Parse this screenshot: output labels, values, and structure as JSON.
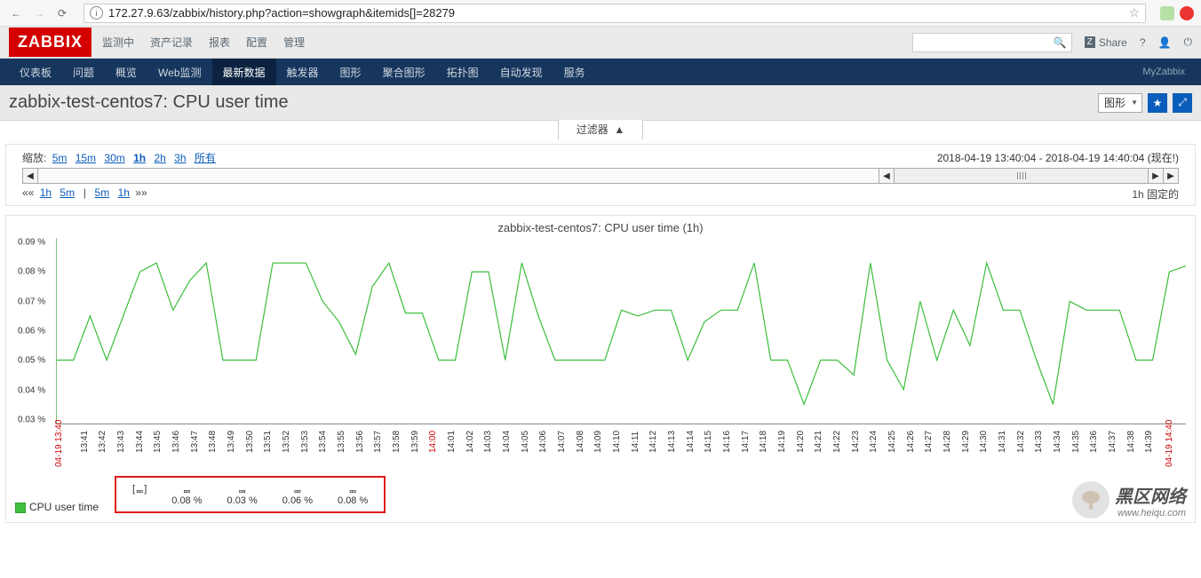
{
  "browser": {
    "url": "172.27.9.63/zabbix/history.php?action=showgraph&itemids[]=28279"
  },
  "topnav": {
    "logo": "ZABBIX",
    "items": [
      "监测中",
      "资产记录",
      "报表",
      "配置",
      "管理"
    ],
    "share": "Share"
  },
  "subnav": {
    "items": [
      "仪表板",
      "问题",
      "概览",
      "Web监测",
      "最新数据",
      "触发器",
      "图形",
      "聚合图形",
      "拓扑图",
      "自动发现",
      "服务"
    ],
    "active_index": 4,
    "right": "MyZabbix"
  },
  "pagehead": {
    "title": "zabbix-test-centos7: CPU user time",
    "dropdown": "图形"
  },
  "filter_tab": "过滤器",
  "controls": {
    "zoom_label": "缩放:",
    "zoom_opts": [
      "5m",
      "15m",
      "30m",
      "1h",
      "2h",
      "3h",
      "所有"
    ],
    "zoom_active": "1h",
    "timerange": "2018-04-19 13:40:04 - 2018-04-19 14:40:04 (现在!)",
    "row3_left_prefix": "««",
    "row3_left": [
      "1h",
      "5m"
    ],
    "row3_sep": "|",
    "row3_right": [
      "5m",
      "1h"
    ],
    "row3_right_suffix": "»»",
    "fixed": "1h  固定的"
  },
  "chart_data": {
    "type": "line",
    "title": "zabbix-test-centos7: CPU user time (1h)",
    "ylabel": "%",
    "ylim": [
      0.03,
      0.09
    ],
    "yticks": [
      "0.09 %",
      "0.08 %",
      "0.07 %",
      "0.06 %",
      "0.05 %",
      "0.04 %",
      "0.03 %"
    ],
    "x_start": "04-19 13:40",
    "x_end": "04-19 14:40",
    "xticks_red": [
      "14:00"
    ],
    "xticks": [
      "13:41",
      "13:42",
      "13:43",
      "13:44",
      "13:45",
      "13:46",
      "13:47",
      "13:48",
      "13:49",
      "13:50",
      "13:51",
      "13:52",
      "13:53",
      "13:54",
      "13:55",
      "13:56",
      "13:57",
      "13:58",
      "13:59",
      "14:00",
      "14:01",
      "14:02",
      "14:03",
      "14:04",
      "14:05",
      "14:06",
      "14:07",
      "14:08",
      "14:09",
      "14:10",
      "14:11",
      "14:12",
      "14:13",
      "14:14",
      "14:15",
      "14:16",
      "14:17",
      "14:18",
      "14:19",
      "14:20",
      "14:21",
      "14:22",
      "14:23",
      "14:24",
      "14:25",
      "14:26",
      "14:27",
      "14:28",
      "14:29",
      "14:30",
      "14:31",
      "14:32",
      "14:33",
      "14:34",
      "14:35",
      "14:36",
      "14:37",
      "14:38",
      "14:39"
    ],
    "values": [
      0.05,
      0.05,
      0.065,
      0.05,
      0.065,
      0.08,
      0.083,
      0.067,
      0.077,
      0.083,
      0.05,
      0.05,
      0.05,
      0.083,
      0.083,
      0.083,
      0.07,
      0.063,
      0.052,
      0.075,
      0.083,
      0.066,
      0.066,
      0.05,
      0.05,
      0.08,
      0.08,
      0.05,
      0.083,
      0.065,
      0.05,
      0.05,
      0.05,
      0.05,
      0.067,
      0.065,
      0.067,
      0.067,
      0.05,
      0.063,
      0.067,
      0.067,
      0.083,
      0.05,
      0.05,
      0.035,
      0.05,
      0.05,
      0.045,
      0.083,
      0.05,
      0.04,
      0.07,
      0.05,
      0.067,
      0.055,
      0.083,
      0.067,
      0.067,
      0.05,
      0.035,
      0.07,
      0.067,
      0.067,
      0.067,
      0.05,
      0.05,
      0.08,
      0.082
    ],
    "legend": {
      "name": "CPU user time",
      "stats": [
        {
          "h": "[ᆷᆷ]",
          "v": ""
        },
        {
          "h": "ᆷᆷ",
          "v": "0.08 %"
        },
        {
          "h": "ᆷᆷ",
          "v": "0.03 %"
        },
        {
          "h": "ᆷᆷ",
          "v": "0.06 %"
        },
        {
          "h": "ᆷᆷ",
          "v": "0.08 %"
        }
      ]
    }
  },
  "watermark": {
    "big": "黑区网络",
    "small": "www.heiqu.com"
  }
}
